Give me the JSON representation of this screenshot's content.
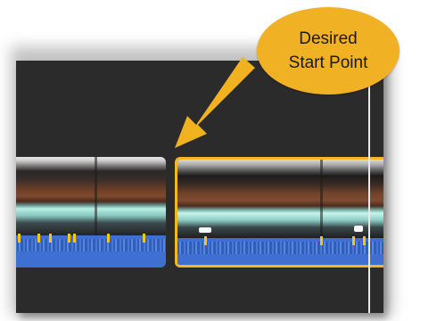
{
  "callout": {
    "line1": "Desired",
    "line2": "Start Point",
    "color": "#f1b124"
  },
  "arrow": {
    "icon": "arrow-down-left-icon",
    "color": "#f0b21f"
  },
  "timeline": {
    "background": "#2b2b2b",
    "selected_clip_border": "#f2b824",
    "audio_color": "#3f6fd0",
    "playhead_color": "#e9e9e9"
  }
}
